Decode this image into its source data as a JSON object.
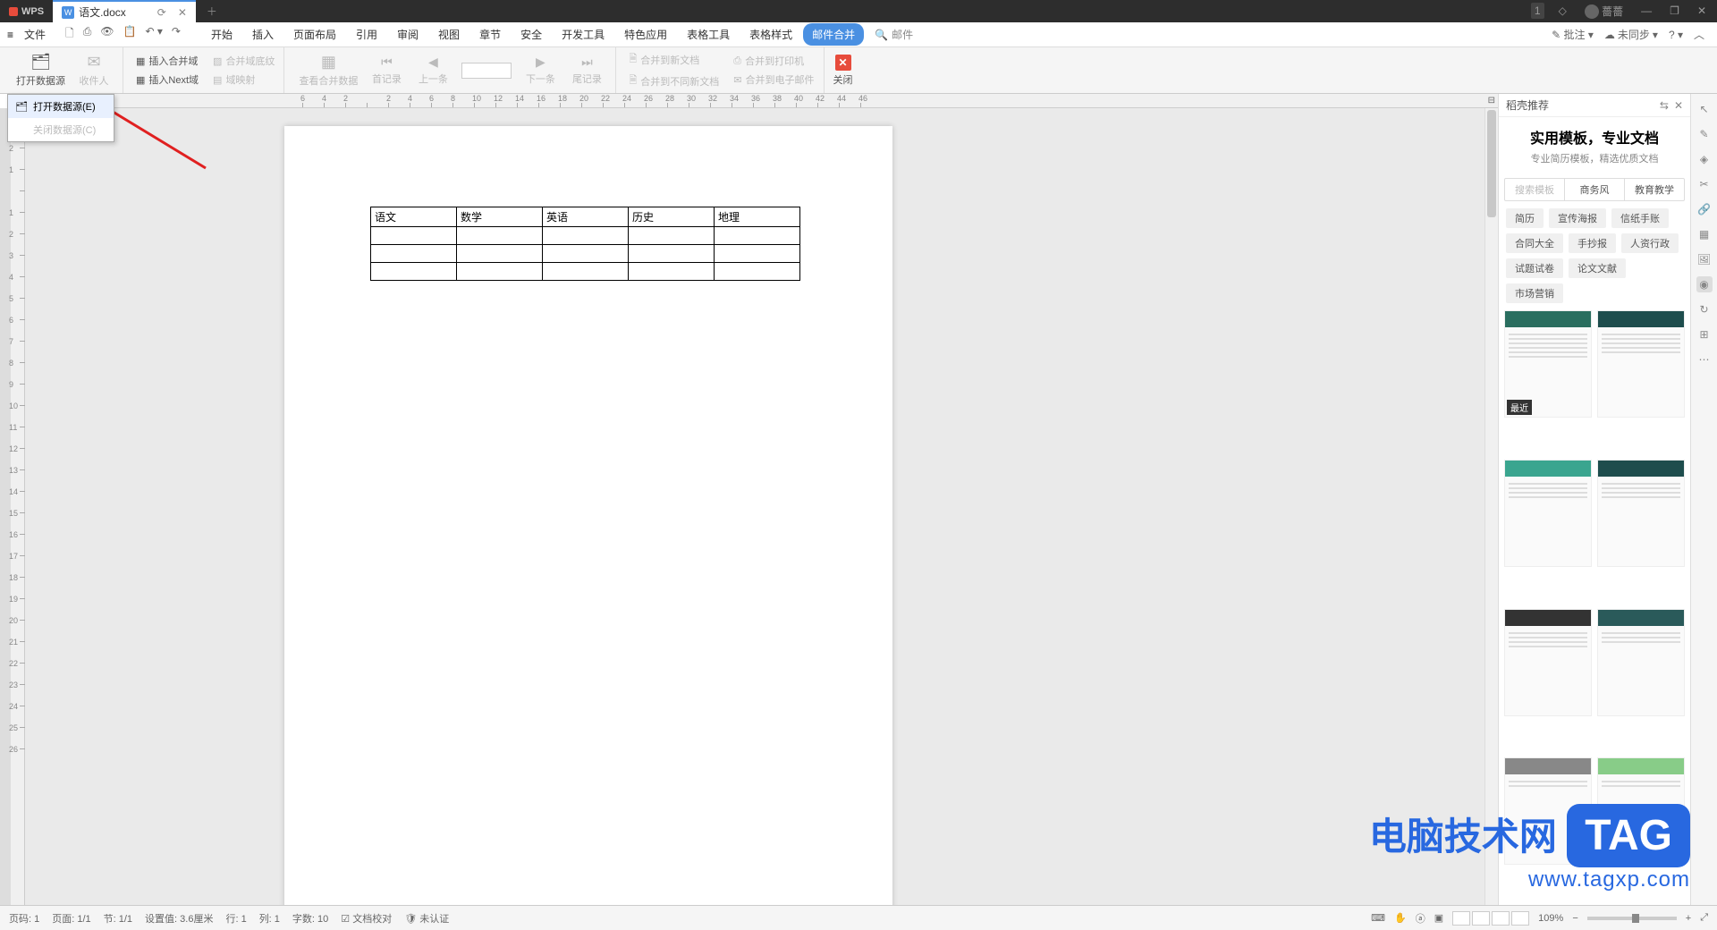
{
  "titlebar": {
    "app": "WPS",
    "doc_title": "语文.docx",
    "notif_count": "1",
    "user_name": "薔薔"
  },
  "menubar": {
    "file": "文件",
    "tabs": [
      "开始",
      "插入",
      "页面布局",
      "引用",
      "审阅",
      "视图",
      "章节",
      "安全",
      "开发工具",
      "特色应用",
      "表格工具",
      "表格样式",
      "邮件合并"
    ],
    "active_tab": "邮件合并",
    "search_placeholder": "邮件",
    "annotate": "批注",
    "sync": "未同步"
  },
  "ribbon": {
    "open_source": "打开数据源",
    "recipients": "收件人",
    "insert_merge_field": "插入合并域",
    "insert_next": "插入Next域",
    "merge_shading": "合并域底纹",
    "view_merge_data": "查看合并数据",
    "domain_map": "域映射",
    "first_record": "首记录",
    "prev": "上一条",
    "next": "下一条",
    "last_record": "尾记录",
    "merge_new_doc": "合并到新文档",
    "merge_diff_doc": "合并到不同新文档",
    "merge_printer": "合并到打印机",
    "merge_email": "合并到电子邮件",
    "close": "关闭"
  },
  "dropdown": {
    "open": "打开数据源(E)",
    "close": "关闭数据源(C)"
  },
  "table": {
    "headers": [
      "语文",
      "数学",
      "英语",
      "历史",
      "地理"
    ]
  },
  "right_panel": {
    "title": "稻壳推荐",
    "hero_title": "实用模板，专业文档",
    "hero_subtitle": "专业简历模板，精选优质文档",
    "search_placeholder": "搜索模板",
    "top_tabs": [
      "商务风",
      "教育教学"
    ],
    "chips": [
      "简历",
      "宣传海报",
      "信纸手账",
      "合同大全",
      "手抄报",
      "人资行政",
      "试题试卷",
      "论文文献",
      "市场营销"
    ],
    "recent_badge": "最近"
  },
  "statusbar": {
    "page_no": "页码: 1",
    "page_of": "页面: 1/1",
    "section": "节: 1/1",
    "position": "设置值: 3.6厘米",
    "line": "行: 1",
    "col": "列: 1",
    "words": "字数: 10",
    "proof": "文档校对",
    "cert": "未认证",
    "zoom": "109%"
  },
  "watermark": {
    "brand": "电脑技术网",
    "tag": "TAG",
    "url": "www.tagxp.com"
  }
}
